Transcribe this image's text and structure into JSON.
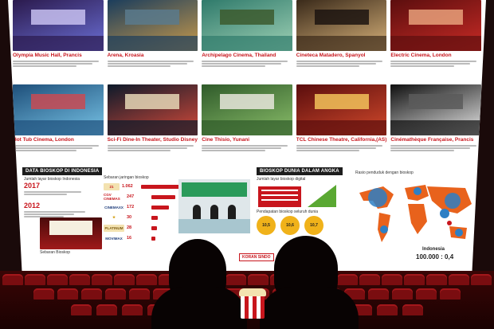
{
  "top_row": [
    {
      "title": "Olympia Music Hall, Prancis",
      "palette": [
        "#2b1a4d",
        "#6b6fd6",
        "#c7c0f0"
      ]
    },
    {
      "title": "Arena, Kroasia",
      "palette": [
        "#1b3d5c",
        "#c99a4b",
        "#5a7a8c"
      ]
    },
    {
      "title": "Archipelago Cinema, Thailand",
      "palette": [
        "#2f7a6b",
        "#9fd1b5",
        "#3c5a2e"
      ]
    },
    {
      "title": "Cineteca Matadero, Spanyol",
      "palette": [
        "#3a2a1a",
        "#d8b27a",
        "#1c1410"
      ]
    },
    {
      "title": "Electric Cinema, London",
      "palette": [
        "#5c0e0e",
        "#c82b26",
        "#e7a07a"
      ]
    }
  ],
  "bottom_row": [
    {
      "title": "Hot Tub Cinema, London",
      "palette": [
        "#1e4f7a",
        "#79c5e8",
        "#c94a52"
      ]
    },
    {
      "title": "Sci-Fi Dine-In Theater, Studio Disney Hollywood",
      "palette": [
        "#0d1a2a",
        "#d64a3a",
        "#e6d7b6"
      ]
    },
    {
      "title": "Cine Thisio, Yunani",
      "palette": [
        "#2f5a2a",
        "#8bbf6a",
        "#e8e6dc"
      ]
    },
    {
      "title": "TCL Chinese Theatre, California,(AS)",
      "palette": [
        "#5a0d0d",
        "#d34a2c",
        "#f2c25a"
      ]
    },
    {
      "title": "Cinémathèque Française, Prancis",
      "palette": [
        "#101010",
        "#e8e8e8",
        "#5a5a5a"
      ]
    }
  ],
  "indonesia": {
    "header": "DATA BIOSKOP DI INDONESIA",
    "sub": "Jumlah layar bioskop Indonesia",
    "years": [
      "2017",
      "2012"
    ],
    "chains_title": "Sebaran jaringan bioskop",
    "chains": [
      {
        "name": "21",
        "value": "1.062",
        "width": 62,
        "color": "#c8161d",
        "bg": "#f3e2b0"
      },
      {
        "name": "CGV CINEMAS",
        "value": "247",
        "width": 30,
        "color": "#c8161d",
        "bg": "#fff"
      },
      {
        "name": "CINEMAXX",
        "value": "172",
        "width": 22,
        "color": "#1d3c7a",
        "bg": "#fff"
      },
      {
        "name": "★",
        "value": "30",
        "width": 8,
        "color": "#d4a017",
        "bg": "#fff"
      },
      {
        "name": "PLATINUM",
        "value": "28",
        "width": 7,
        "color": "#7a5a10",
        "bg": "#f3e2b0"
      },
      {
        "name": "MOVIMAX",
        "value": "16",
        "width": 5,
        "color": "#1d3c7a",
        "bg": "#fff"
      }
    ],
    "caption": "Sebaran Bioskop"
  },
  "world": {
    "header": "BIOSKOP DUNIA DALAM ANGKA",
    "bar_title": "Jumlah layar bioskop digital",
    "bar_title2": "Jumlah layar bioskop 3D",
    "income_title": "Pendapatan bioskop seluruh dunia",
    "bubbles": [
      "10,5",
      "10,6",
      "10,7"
    ],
    "map_title": "Rasio penduduk dengan bioskop",
    "indonesia_label": "Indonesia",
    "indonesia_ratio": "100.000 : 0,4"
  },
  "brand": "KORAN SINDO"
}
